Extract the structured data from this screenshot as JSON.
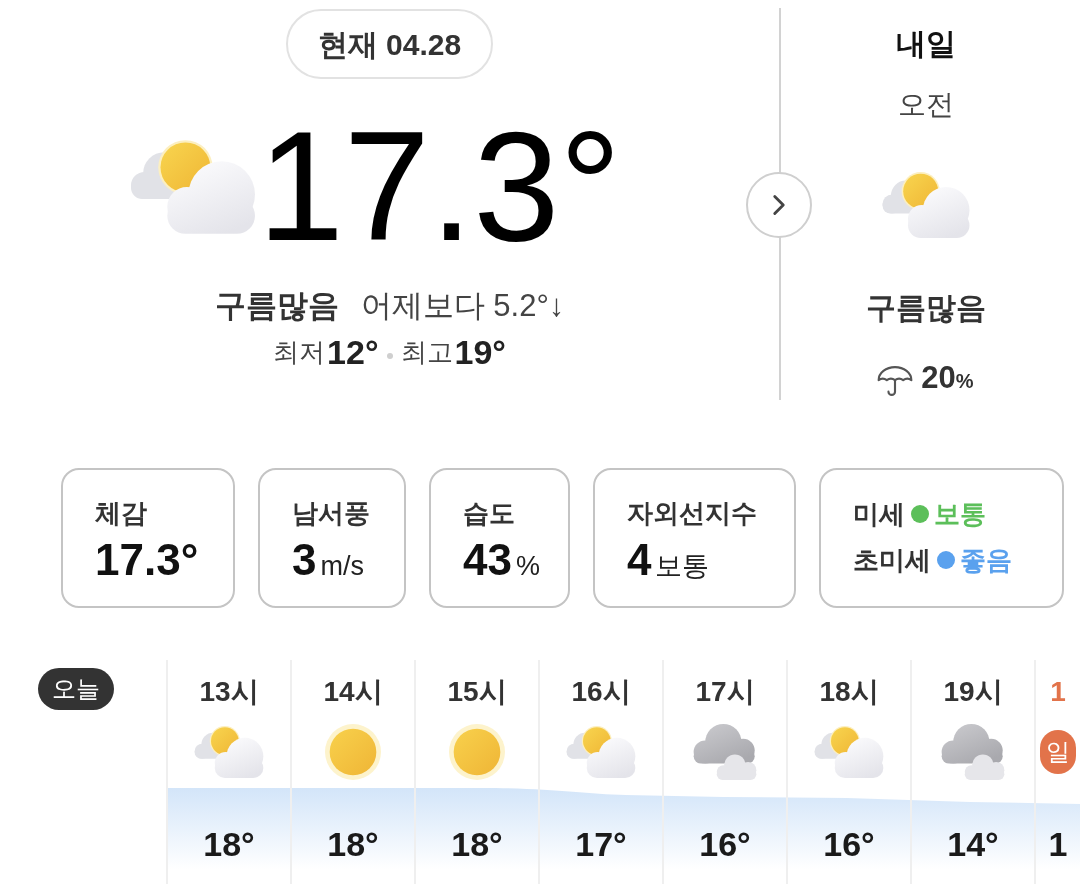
{
  "current": {
    "date": "현재 04.28",
    "temperature": "17.3°",
    "condition": "구름많음",
    "comparison": "어제보다 5.2°↓",
    "low_label": "최저",
    "low": "12°",
    "high_label": "최고",
    "high": "19°"
  },
  "tomorrow": {
    "title": "내일",
    "period": "오전",
    "condition": "구름많음",
    "rain_chance": "20",
    "rain_unit": "%"
  },
  "details": [
    {
      "kind": "reading",
      "label": "체감",
      "value": "17.3°"
    },
    {
      "kind": "reading",
      "label": "남서풍",
      "value": "3",
      "unit": "m/s"
    },
    {
      "kind": "reading",
      "label": "습도",
      "value": "43",
      "unit": "%"
    },
    {
      "kind": "reading",
      "label": "자외선지수",
      "value": "4",
      "unit": "보통"
    },
    {
      "kind": "air",
      "rows": [
        {
          "label": "미세",
          "status": "보통",
          "color": "#5cbf5a"
        },
        {
          "label": "초미세",
          "status": "좋음",
          "color": "#5aa1ee"
        }
      ]
    }
  ],
  "hourly": {
    "day_label": "오늘",
    "items": [
      {
        "hour": "13시",
        "kind": "partly",
        "temp": "18°",
        "highlighted": false
      },
      {
        "hour": "14시",
        "kind": "sunny",
        "temp": "18°",
        "highlighted": false
      },
      {
        "hour": "15시",
        "kind": "sunny",
        "temp": "18°",
        "highlighted": false
      },
      {
        "hour": "16시",
        "kind": "partly",
        "temp": "17°",
        "highlighted": false
      },
      {
        "hour": "17시",
        "kind": "cloudy",
        "temp": "16°",
        "highlighted": false
      },
      {
        "hour": "18시",
        "kind": "partly",
        "temp": "16°",
        "highlighted": false
      },
      {
        "hour": "19시",
        "kind": "cloudy",
        "temp": "14°",
        "highlighted": false
      },
      {
        "hour": "1",
        "kind": "badge",
        "badge": "일",
        "temp": "1",
        "highlighted": true
      }
    ]
  }
}
